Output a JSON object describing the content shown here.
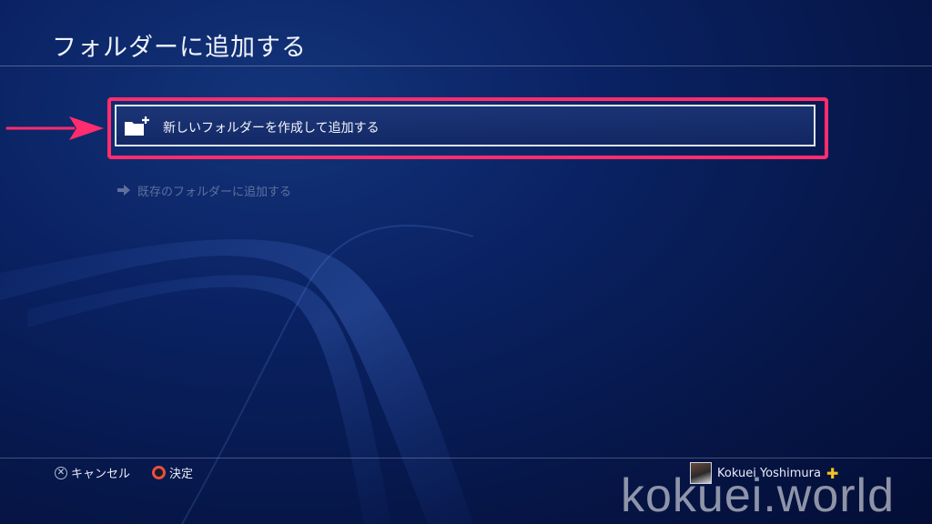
{
  "header": {
    "title": "フォルダーに追加する"
  },
  "options": {
    "new_folder": {
      "label": "新しいフォルダーを作成して追加する",
      "icon": "folder-add-icon"
    },
    "existing_folder": {
      "label": "既存のフォルダーに追加する",
      "icon": "arrow-right-icon"
    }
  },
  "footer": {
    "cancel": {
      "icon": "cross-button-icon",
      "label": "キャンセル"
    },
    "confirm": {
      "icon": "circle-button-icon",
      "label": "決定"
    }
  },
  "user": {
    "name": "Kokuei Yoshimura",
    "badge_icon": "playstation-plus-icon"
  },
  "watermark": "kokuei.world",
  "colors": {
    "highlight": "#ff2d6e",
    "background": "#0a2263"
  }
}
